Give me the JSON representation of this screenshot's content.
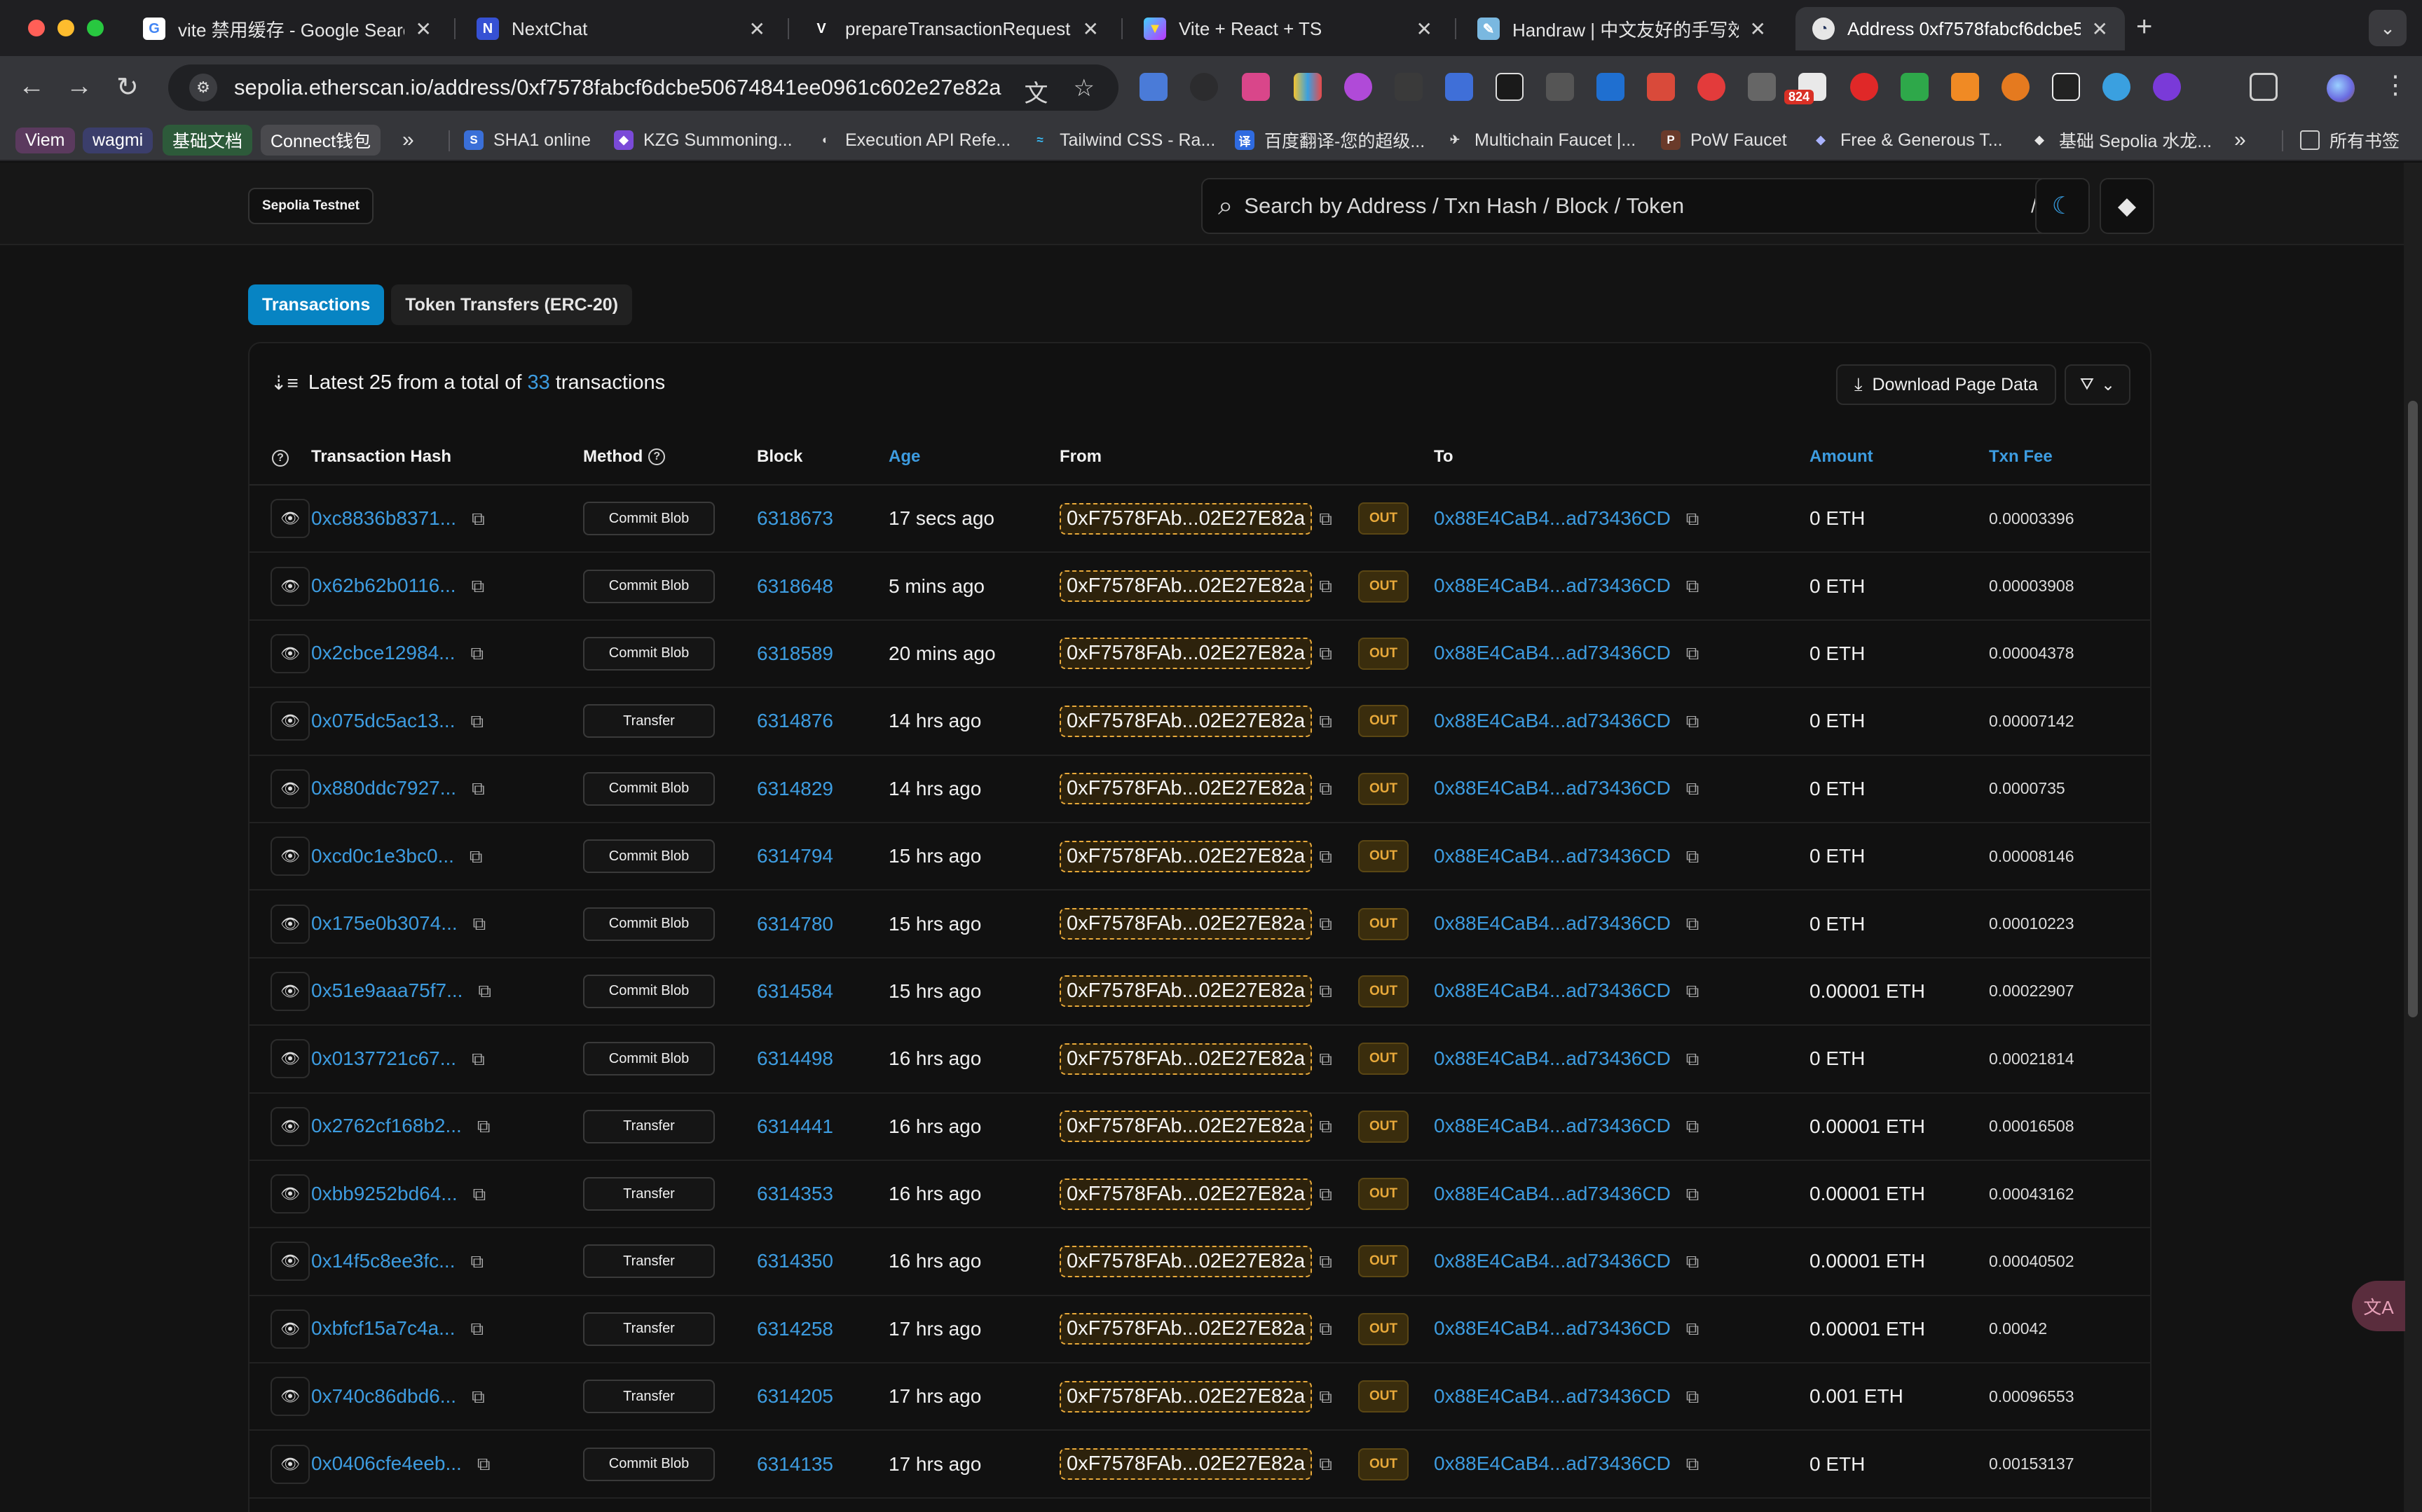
{
  "browser": {
    "tabs": [
      {
        "title": "vite 禁用缓存 - Google Search",
        "favicon": "google-icon"
      },
      {
        "title": "NextChat",
        "favicon": "nextchat-icon"
      },
      {
        "title": "prepareTransactionRequest ·",
        "favicon": "viem-icon"
      },
      {
        "title": "Vite + React + TS",
        "favicon": "vite-icon"
      },
      {
        "title": "Handraw | 中文友好的手写效果",
        "favicon": "handraw-icon"
      },
      {
        "title": "Address 0xf7578fabcf6dcbe5",
        "favicon": "etherscan-icon"
      }
    ],
    "url": "sepolia.etherscan.io/address/0xf7578fabcf6dcbe50674841ee0961c602e27e82a",
    "extension_badge": "824",
    "bookmarks": [
      {
        "label": "Viem",
        "kind": "pill"
      },
      {
        "label": "wagmi",
        "kind": "pill"
      },
      {
        "label": "基础文档",
        "kind": "pill"
      },
      {
        "label": "Connect钱包",
        "kind": "pill"
      },
      {
        "label": "SHA1 online"
      },
      {
        "label": "KZG Summoning..."
      },
      {
        "label": "Execution API Refe..."
      },
      {
        "label": "Tailwind CSS - Ra..."
      },
      {
        "label": "百度翻译-您的超级..."
      },
      {
        "label": "Multichain Faucet |..."
      },
      {
        "label": "PoW Faucet"
      },
      {
        "label": "Free & Generous T..."
      },
      {
        "label": "基础 Sepolia 水龙..."
      }
    ],
    "all_bookmarks_label": "所有书签"
  },
  "header": {
    "network_badge": "Sepolia Testnet",
    "search_placeholder": "Search by Address / Txn Hash / Block / Token",
    "search_shortcut": "/"
  },
  "tabs": {
    "transactions": "Transactions",
    "token_transfers": "Token Transfers (ERC-20)"
  },
  "summary": {
    "prefix": "Latest 25 from a total of",
    "count": "33",
    "suffix": "transactions",
    "download_label": "Download Page Data"
  },
  "columns": {
    "hash": "Transaction Hash",
    "method": "Method",
    "block": "Block",
    "age": "Age",
    "from": "From",
    "to": "To",
    "amount": "Amount",
    "fee": "Txn Fee"
  },
  "transactions": [
    {
      "hash": "0xc8836b8371...",
      "method": "Commit Blob",
      "block": "6318673",
      "age": "17 secs ago",
      "from": "0xF7578FAb...02E27E82a",
      "direction": "OUT",
      "to": "0x88E4CaB4...ad73436CD",
      "amount": "0 ETH",
      "fee": "0.00003396"
    },
    {
      "hash": "0x62b62b0116...",
      "method": "Commit Blob",
      "block": "6318648",
      "age": "5 mins ago",
      "from": "0xF7578FAb...02E27E82a",
      "direction": "OUT",
      "to": "0x88E4CaB4...ad73436CD",
      "amount": "0 ETH",
      "fee": "0.00003908"
    },
    {
      "hash": "0x2cbce12984...",
      "method": "Commit Blob",
      "block": "6318589",
      "age": "20 mins ago",
      "from": "0xF7578FAb...02E27E82a",
      "direction": "OUT",
      "to": "0x88E4CaB4...ad73436CD",
      "amount": "0 ETH",
      "fee": "0.00004378"
    },
    {
      "hash": "0x075dc5ac13...",
      "method": "Transfer",
      "block": "6314876",
      "age": "14 hrs ago",
      "from": "0xF7578FAb...02E27E82a",
      "direction": "OUT",
      "to": "0x88E4CaB4...ad73436CD",
      "amount": "0 ETH",
      "fee": "0.00007142"
    },
    {
      "hash": "0x880ddc7927...",
      "method": "Commit Blob",
      "block": "6314829",
      "age": "14 hrs ago",
      "from": "0xF7578FAb...02E27E82a",
      "direction": "OUT",
      "to": "0x88E4CaB4...ad73436CD",
      "amount": "0 ETH",
      "fee": "0.0000735"
    },
    {
      "hash": "0xcd0c1e3bc0...",
      "method": "Commit Blob",
      "block": "6314794",
      "age": "15 hrs ago",
      "from": "0xF7578FAb...02E27E82a",
      "direction": "OUT",
      "to": "0x88E4CaB4...ad73436CD",
      "amount": "0 ETH",
      "fee": "0.00008146"
    },
    {
      "hash": "0x175e0b3074...",
      "method": "Commit Blob",
      "block": "6314780",
      "age": "15 hrs ago",
      "from": "0xF7578FAb...02E27E82a",
      "direction": "OUT",
      "to": "0x88E4CaB4...ad73436CD",
      "amount": "0 ETH",
      "fee": "0.00010223"
    },
    {
      "hash": "0x51e9aaa75f7...",
      "method": "Commit Blob",
      "block": "6314584",
      "age": "15 hrs ago",
      "from": "0xF7578FAb...02E27E82a",
      "direction": "OUT",
      "to": "0x88E4CaB4...ad73436CD",
      "amount": "0.00001 ETH",
      "fee": "0.00022907"
    },
    {
      "hash": "0x0137721c67...",
      "method": "Commit Blob",
      "block": "6314498",
      "age": "16 hrs ago",
      "from": "0xF7578FAb...02E27E82a",
      "direction": "OUT",
      "to": "0x88E4CaB4...ad73436CD",
      "amount": "0 ETH",
      "fee": "0.00021814"
    },
    {
      "hash": "0x2762cf168b2...",
      "method": "Transfer",
      "block": "6314441",
      "age": "16 hrs ago",
      "from": "0xF7578FAb...02E27E82a",
      "direction": "OUT",
      "to": "0x88E4CaB4...ad73436CD",
      "amount": "0.00001 ETH",
      "fee": "0.00016508"
    },
    {
      "hash": "0xbb9252bd64...",
      "method": "Transfer",
      "block": "6314353",
      "age": "16 hrs ago",
      "from": "0xF7578FAb...02E27E82a",
      "direction": "OUT",
      "to": "0x88E4CaB4...ad73436CD",
      "amount": "0.00001 ETH",
      "fee": "0.00043162"
    },
    {
      "hash": "0x14f5c8ee3fc...",
      "method": "Transfer",
      "block": "6314350",
      "age": "16 hrs ago",
      "from": "0xF7578FAb...02E27E82a",
      "direction": "OUT",
      "to": "0x88E4CaB4...ad73436CD",
      "amount": "0.00001 ETH",
      "fee": "0.00040502"
    },
    {
      "hash": "0xbfcf15a7c4a...",
      "method": "Transfer",
      "block": "6314258",
      "age": "17 hrs ago",
      "from": "0xF7578FAb...02E27E82a",
      "direction": "OUT",
      "to": "0x88E4CaB4...ad73436CD",
      "amount": "0.00001 ETH",
      "fee": "0.00042"
    },
    {
      "hash": "0x740c86dbd6...",
      "method": "Transfer",
      "block": "6314205",
      "age": "17 hrs ago",
      "from": "0xF7578FAb...02E27E82a",
      "direction": "OUT",
      "to": "0x88E4CaB4...ad73436CD",
      "amount": "0.001 ETH",
      "fee": "0.00096553"
    },
    {
      "hash": "0x0406cfe4eeb...",
      "method": "Commit Blob",
      "block": "6314135",
      "age": "17 hrs ago",
      "from": "0xF7578FAb...02E27E82a",
      "direction": "OUT",
      "to": "0x88E4CaB4...ad73436CD",
      "amount": "0 ETH",
      "fee": "0.00153137"
    }
  ],
  "colors": {
    "accent": "#0784c3",
    "link": "#3d9ce0",
    "out_badge": "#e8a93a"
  }
}
